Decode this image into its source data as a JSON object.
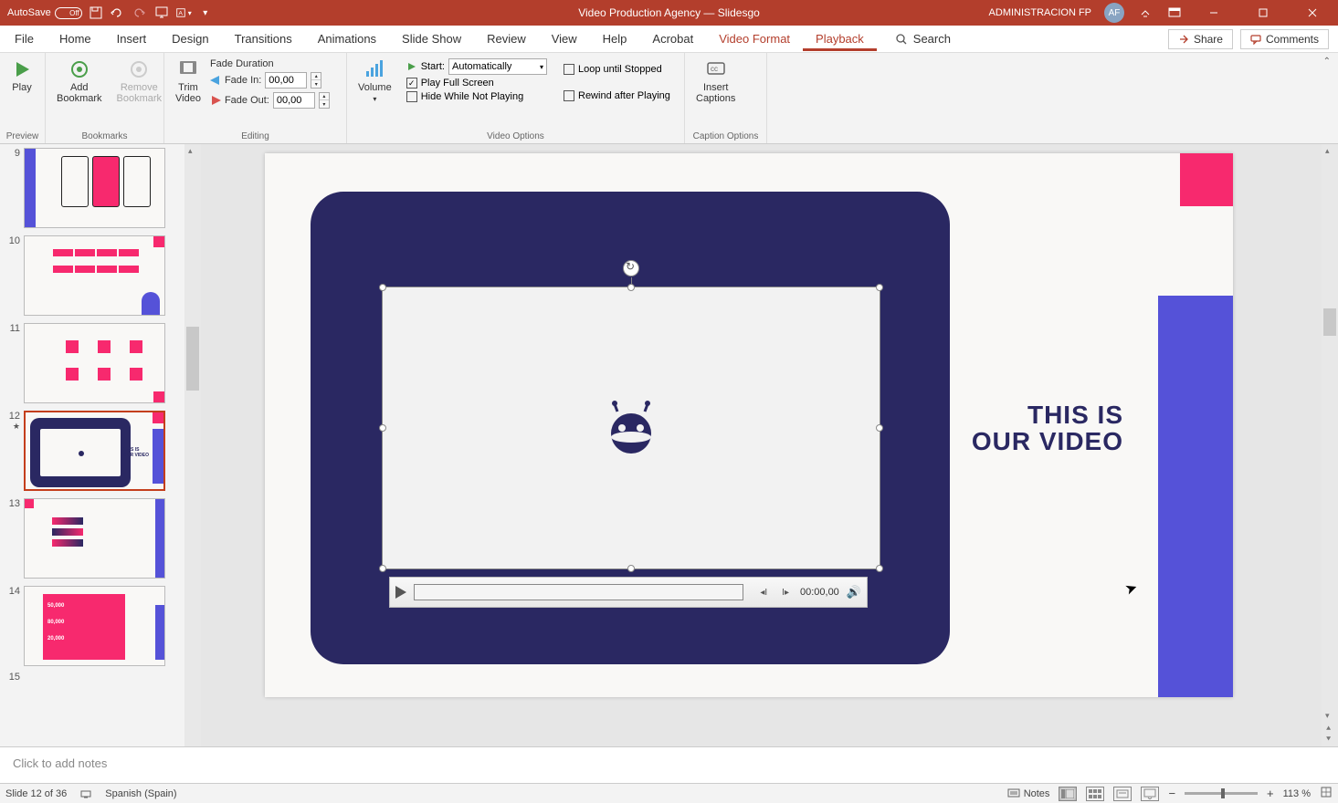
{
  "titlebar": {
    "autosave": "AutoSave",
    "autosave_state": "Off",
    "doc_title": "Video Production Agency — Slidesgo",
    "account": "ADMINISTRACION FP",
    "avatar": "AF"
  },
  "tabs": {
    "file": "File",
    "home": "Home",
    "insert": "Insert",
    "design": "Design",
    "transitions": "Transitions",
    "animations": "Animations",
    "slideshow": "Slide Show",
    "review": "Review",
    "view": "View",
    "help": "Help",
    "acrobat": "Acrobat",
    "video_format": "Video Format",
    "playback": "Playback",
    "search": "Search",
    "share": "Share",
    "comments": "Comments"
  },
  "ribbon": {
    "preview": {
      "play": "Play",
      "group": "Preview"
    },
    "bookmarks": {
      "add": "Add\nBookmark",
      "remove": "Remove\nBookmark",
      "group": "Bookmarks"
    },
    "editing": {
      "trim": "Trim\nVideo",
      "fade_duration": "Fade Duration",
      "fade_in": "Fade In:",
      "fade_in_value": "00,00",
      "fade_out": "Fade Out:",
      "fade_out_value": "00,00",
      "group": "Editing"
    },
    "video_options": {
      "volume": "Volume",
      "start": "Start:",
      "start_value": "Automatically",
      "play_full": "Play Full Screen",
      "hide": "Hide While Not Playing",
      "loop": "Loop until Stopped",
      "rewind": "Rewind after Playing",
      "group": "Video Options"
    },
    "captions": {
      "insert": "Insert\nCaptions",
      "group": "Caption Options"
    }
  },
  "thumbs": {
    "n9": "9",
    "n10": "10",
    "n11": "11",
    "n12": "12",
    "n13": "13",
    "n14": "14",
    "n15": "15"
  },
  "slide": {
    "title_l1": "THIS IS",
    "title_l2": "OUR VIDEO"
  },
  "player": {
    "time": "00:00,00"
  },
  "notes": {
    "placeholder": "Click to add notes"
  },
  "statusbar": {
    "slide_counter": "Slide 12 of 36",
    "language": "Spanish (Spain)",
    "notes": "Notes",
    "zoom": "113 %"
  }
}
